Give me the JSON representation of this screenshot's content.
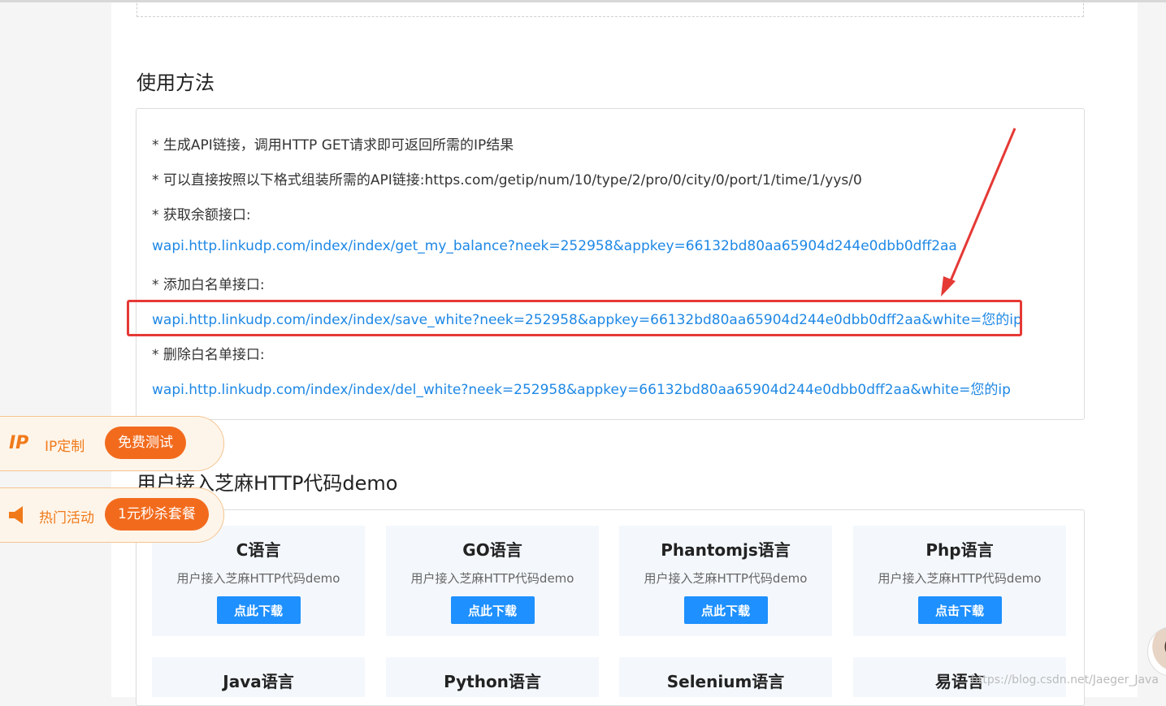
{
  "usage": {
    "title": "使用方法",
    "lines": [
      "* 生成API链接，调用HTTP GET请求即可返回所需的IP结果",
      "* 可以直接按照以下格式组装所需的API链接:https.com/getip/num/10/type/2/pro/0/city/0/port/1/time/1/yys/0",
      "* 获取余额接口:",
      "wapi.http.linkudp.com/index/index/get_my_balance?neek=252958&appkey=66132bd80aa65904d244e0dbb0dff2aa",
      "* 添加白名单接口:",
      "wapi.http.linkudp.com/index/index/save_white?neek=252958&appkey=66132bd80aa65904d244e0dbb0dff2aa&white=您的ip",
      "* 删除白名单接口:",
      "wapi.http.linkudp.com/index/index/del_white?neek=252958&appkey=66132bd80aa65904d244e0dbb0dff2aa&white=您的ip"
    ]
  },
  "demo": {
    "title": "用户接入芝麻HTTP代码demo",
    "cards": [
      {
        "title": "C语言",
        "subtitle": "用户接入芝麻HTTP代码demo",
        "button": "点此下载"
      },
      {
        "title": "GO语言",
        "subtitle": "用户接入芝麻HTTP代码demo",
        "button": "点此下载"
      },
      {
        "title": "Phantomjs语言",
        "subtitle": "用户接入芝麻HTTP代码demo",
        "button": "点此下载"
      },
      {
        "title": "Php语言",
        "subtitle": "用户接入芝麻HTTP代码demo",
        "button": "点击下载"
      },
      {
        "title": "Java语言"
      },
      {
        "title": "Python语言"
      },
      {
        "title": "Selenium语言"
      },
      {
        "title": "易语言"
      }
    ]
  },
  "floating": {
    "ip_logo": "IP",
    "ip_label": "IP定制",
    "ip_button": "免费测试",
    "activity_label": "热门活动",
    "activity_button": "1元秒杀套餐"
  },
  "watermark": "https://blog.csdn.net/Jaeger_Java",
  "colors": {
    "link": "#1e88e5",
    "accent": "#f26b1d",
    "highlight": "#e53935",
    "button": "#1e90ff"
  }
}
